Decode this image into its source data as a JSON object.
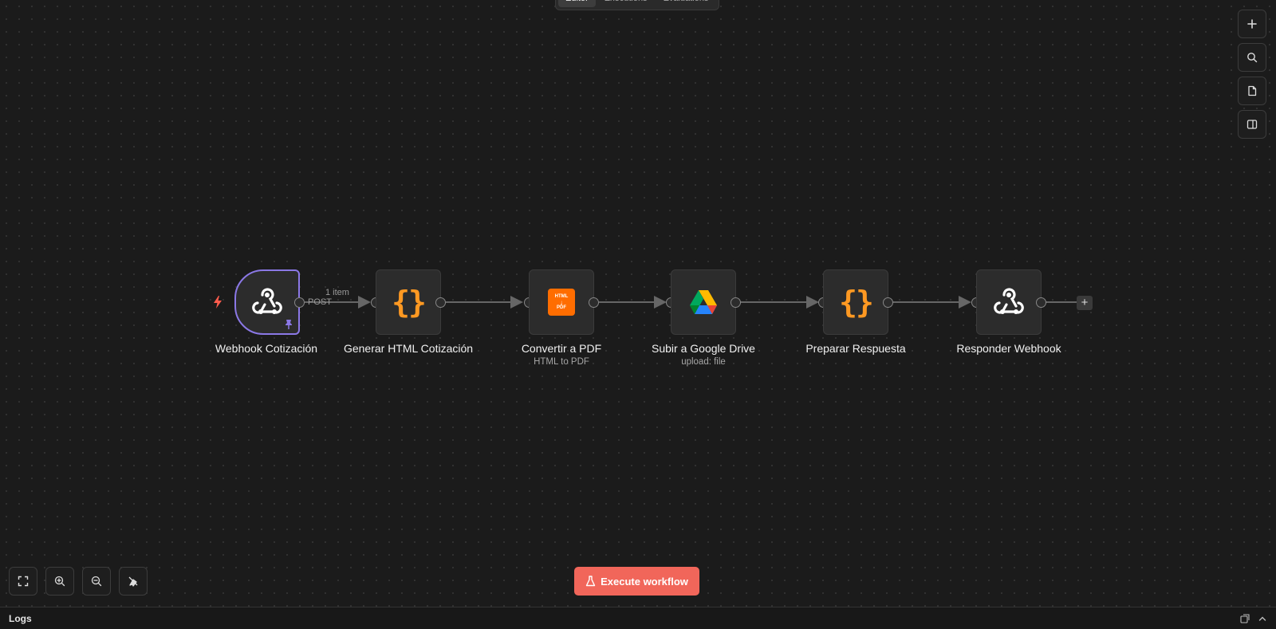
{
  "tabs": [
    {
      "label": "Editor",
      "active": true
    },
    {
      "label": "Executions",
      "active": false
    },
    {
      "label": "Evaluations",
      "active": false
    }
  ],
  "right_toolbar": [
    "plus-icon",
    "search-icon",
    "sticky-note-icon",
    "panel-icon"
  ],
  "nodes": [
    {
      "name": "Webhook Cotización",
      "subtitle": "",
      "icon": "webhook-icon"
    },
    {
      "name": "Generar HTML Cotización",
      "subtitle": "",
      "icon": "code-braces-icon"
    },
    {
      "name": "Convertir a PDF",
      "subtitle": "HTML to PDF",
      "icon": "html-to-pdf-icon"
    },
    {
      "name": "Subir a Google Drive",
      "subtitle": "upload: file",
      "icon": "google-drive-icon"
    },
    {
      "name": "Preparar Respuesta",
      "subtitle": "",
      "icon": "code-braces-icon"
    },
    {
      "name": "Responder Webhook",
      "subtitle": "",
      "icon": "webhook-icon"
    }
  ],
  "edge_labels": {
    "items": "1 item",
    "method": "POST"
  },
  "html_pdf_icon": {
    "top": "HTML",
    "bottom": "PDF"
  },
  "execute_button": "Execute workflow",
  "logs": {
    "title": "Logs"
  },
  "colors": {
    "accent": "#f1665a",
    "trigger_border": "#8b78e6",
    "code_icon": "#ff9922",
    "pdf_icon_bg": "#ff6d00",
    "bolt": "#ff5c4d"
  }
}
